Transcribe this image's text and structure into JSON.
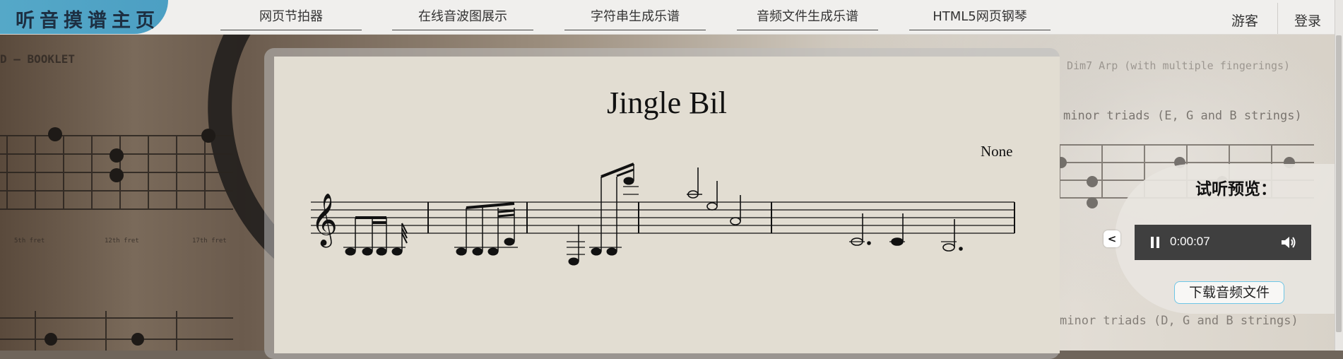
{
  "header": {
    "logo_text": "听音摸谱主页",
    "nav": [
      {
        "label": "网页节拍器"
      },
      {
        "label": "在线音波图展示"
      },
      {
        "label": "字符串生成乐谱"
      },
      {
        "label": "音频文件生成乐谱"
      },
      {
        "label": "HTML5网页钢琴"
      }
    ],
    "guest_label": "游客",
    "login_label": "登录"
  },
  "background": {
    "booklet_text": "D – BOOKLET",
    "fret_label_1": "5th fret",
    "fret_label_2": "12th fret",
    "fret_label_3": "17th fret",
    "line_1": "Dim7 Arp (with multiple fingerings)",
    "line_2": "minor triads (E, G and B strings)",
    "line_3": "minor triads (D, G and B strings)"
  },
  "score": {
    "title": "Jingle Bil",
    "composer": "None"
  },
  "preview": {
    "title": "试听预览：",
    "collapse_label": "<",
    "time": "0:00:07",
    "download_label": "下载音频文件"
  },
  "colors": {
    "logo_bg": "#4c9fc3",
    "player_bg": "#3f3f3f",
    "panel_bg": "#e2ddd2",
    "download_border": "#6ec6e6"
  }
}
